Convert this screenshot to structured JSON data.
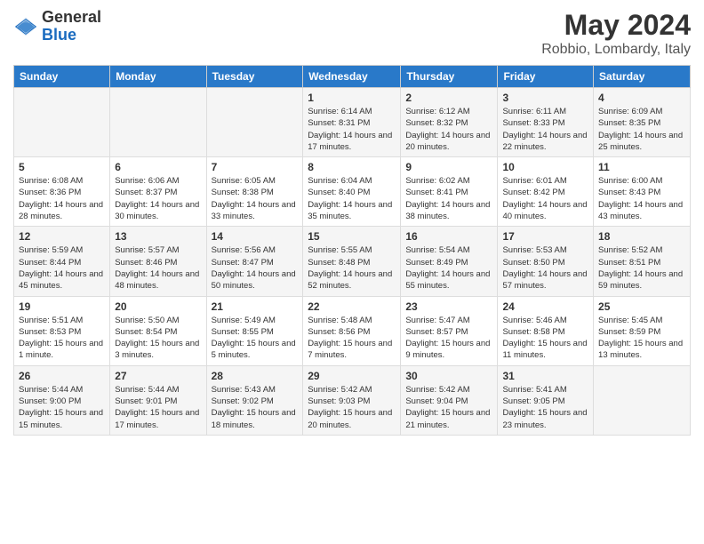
{
  "logo": {
    "general": "General",
    "blue": "Blue"
  },
  "title": "May 2024",
  "location": "Robbio, Lombardy, Italy",
  "days_of_week": [
    "Sunday",
    "Monday",
    "Tuesday",
    "Wednesday",
    "Thursday",
    "Friday",
    "Saturday"
  ],
  "weeks": [
    [
      {
        "day": "",
        "info": ""
      },
      {
        "day": "",
        "info": ""
      },
      {
        "day": "",
        "info": ""
      },
      {
        "day": "1",
        "info": "Sunrise: 6:14 AM\nSunset: 8:31 PM\nDaylight: 14 hours and 17 minutes."
      },
      {
        "day": "2",
        "info": "Sunrise: 6:12 AM\nSunset: 8:32 PM\nDaylight: 14 hours and 20 minutes."
      },
      {
        "day": "3",
        "info": "Sunrise: 6:11 AM\nSunset: 8:33 PM\nDaylight: 14 hours and 22 minutes."
      },
      {
        "day": "4",
        "info": "Sunrise: 6:09 AM\nSunset: 8:35 PM\nDaylight: 14 hours and 25 minutes."
      }
    ],
    [
      {
        "day": "5",
        "info": "Sunrise: 6:08 AM\nSunset: 8:36 PM\nDaylight: 14 hours and 28 minutes."
      },
      {
        "day": "6",
        "info": "Sunrise: 6:06 AM\nSunset: 8:37 PM\nDaylight: 14 hours and 30 minutes."
      },
      {
        "day": "7",
        "info": "Sunrise: 6:05 AM\nSunset: 8:38 PM\nDaylight: 14 hours and 33 minutes."
      },
      {
        "day": "8",
        "info": "Sunrise: 6:04 AM\nSunset: 8:40 PM\nDaylight: 14 hours and 35 minutes."
      },
      {
        "day": "9",
        "info": "Sunrise: 6:02 AM\nSunset: 8:41 PM\nDaylight: 14 hours and 38 minutes."
      },
      {
        "day": "10",
        "info": "Sunrise: 6:01 AM\nSunset: 8:42 PM\nDaylight: 14 hours and 40 minutes."
      },
      {
        "day": "11",
        "info": "Sunrise: 6:00 AM\nSunset: 8:43 PM\nDaylight: 14 hours and 43 minutes."
      }
    ],
    [
      {
        "day": "12",
        "info": "Sunrise: 5:59 AM\nSunset: 8:44 PM\nDaylight: 14 hours and 45 minutes."
      },
      {
        "day": "13",
        "info": "Sunrise: 5:57 AM\nSunset: 8:46 PM\nDaylight: 14 hours and 48 minutes."
      },
      {
        "day": "14",
        "info": "Sunrise: 5:56 AM\nSunset: 8:47 PM\nDaylight: 14 hours and 50 minutes."
      },
      {
        "day": "15",
        "info": "Sunrise: 5:55 AM\nSunset: 8:48 PM\nDaylight: 14 hours and 52 minutes."
      },
      {
        "day": "16",
        "info": "Sunrise: 5:54 AM\nSunset: 8:49 PM\nDaylight: 14 hours and 55 minutes."
      },
      {
        "day": "17",
        "info": "Sunrise: 5:53 AM\nSunset: 8:50 PM\nDaylight: 14 hours and 57 minutes."
      },
      {
        "day": "18",
        "info": "Sunrise: 5:52 AM\nSunset: 8:51 PM\nDaylight: 14 hours and 59 minutes."
      }
    ],
    [
      {
        "day": "19",
        "info": "Sunrise: 5:51 AM\nSunset: 8:53 PM\nDaylight: 15 hours and 1 minute."
      },
      {
        "day": "20",
        "info": "Sunrise: 5:50 AM\nSunset: 8:54 PM\nDaylight: 15 hours and 3 minutes."
      },
      {
        "day": "21",
        "info": "Sunrise: 5:49 AM\nSunset: 8:55 PM\nDaylight: 15 hours and 5 minutes."
      },
      {
        "day": "22",
        "info": "Sunrise: 5:48 AM\nSunset: 8:56 PM\nDaylight: 15 hours and 7 minutes."
      },
      {
        "day": "23",
        "info": "Sunrise: 5:47 AM\nSunset: 8:57 PM\nDaylight: 15 hours and 9 minutes."
      },
      {
        "day": "24",
        "info": "Sunrise: 5:46 AM\nSunset: 8:58 PM\nDaylight: 15 hours and 11 minutes."
      },
      {
        "day": "25",
        "info": "Sunrise: 5:45 AM\nSunset: 8:59 PM\nDaylight: 15 hours and 13 minutes."
      }
    ],
    [
      {
        "day": "26",
        "info": "Sunrise: 5:44 AM\nSunset: 9:00 PM\nDaylight: 15 hours and 15 minutes."
      },
      {
        "day": "27",
        "info": "Sunrise: 5:44 AM\nSunset: 9:01 PM\nDaylight: 15 hours and 17 minutes."
      },
      {
        "day": "28",
        "info": "Sunrise: 5:43 AM\nSunset: 9:02 PM\nDaylight: 15 hours and 18 minutes."
      },
      {
        "day": "29",
        "info": "Sunrise: 5:42 AM\nSunset: 9:03 PM\nDaylight: 15 hours and 20 minutes."
      },
      {
        "day": "30",
        "info": "Sunrise: 5:42 AM\nSunset: 9:04 PM\nDaylight: 15 hours and 21 minutes."
      },
      {
        "day": "31",
        "info": "Sunrise: 5:41 AM\nSunset: 9:05 PM\nDaylight: 15 hours and 23 minutes."
      },
      {
        "day": "",
        "info": ""
      }
    ]
  ]
}
